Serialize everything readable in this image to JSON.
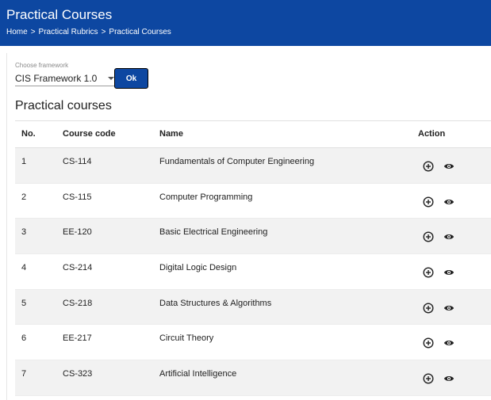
{
  "header": {
    "title": "Practical Courses",
    "breadcrumb": [
      "Home",
      "Practical Rubrics",
      "Practical Courses"
    ],
    "separator": ">"
  },
  "framework": {
    "label": "Choose framework",
    "selected": "CIS Framework 1.0",
    "ok_label": "Ok"
  },
  "section_title": "Practical courses",
  "table": {
    "columns": [
      "No.",
      "Course code",
      "Name",
      "Action"
    ],
    "rows": [
      {
        "no": "1",
        "code": "CS-114",
        "name": "Fundamentals of Computer Engineering"
      },
      {
        "no": "2",
        "code": "CS-115",
        "name": "Computer Programming"
      },
      {
        "no": "3",
        "code": "EE-120",
        "name": "Basic Electrical Engineering"
      },
      {
        "no": "4",
        "code": "CS-214",
        "name": "Digital Logic Design"
      },
      {
        "no": "5",
        "code": "CS-218",
        "name": "Data Structures & Algorithms"
      },
      {
        "no": "6",
        "code": "EE-217",
        "name": "Circuit Theory"
      },
      {
        "no": "7",
        "code": "CS-323",
        "name": "Artificial Intelligence"
      }
    ],
    "action_icons": [
      "add-circle-icon",
      "eye-icon"
    ]
  },
  "colors": {
    "header_bg": "#0d47a1",
    "row_alt": "#f2f2f2"
  }
}
